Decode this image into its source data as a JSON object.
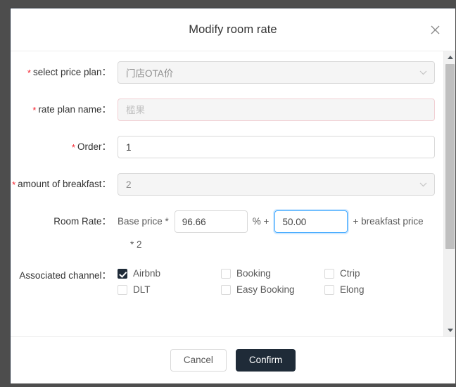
{
  "dialog": {
    "title": "Modify room rate",
    "close_icon": "close-icon"
  },
  "form": {
    "price_plan": {
      "label": "select price plan",
      "required_mark": "*",
      "value": "门店OTA价",
      "disabled": true,
      "chevron": "chevron-down-icon"
    },
    "rate_plan_name": {
      "label": "rate plan name",
      "required_mark": "*",
      "value": "",
      "placeholder": "槛果",
      "disabled": true,
      "error": true
    },
    "order": {
      "label": "Order",
      "required_mark": "*",
      "value": "1"
    },
    "amount_of_breakfast": {
      "label": "amount of breakfast",
      "required_mark": "*",
      "value": "2",
      "disabled": true,
      "chevron": "chevron-down-icon"
    },
    "room_rate": {
      "label": "Room Rate",
      "prefix_text": "Base price *",
      "base_percent_value": "96.66",
      "percent_symbol": "% +",
      "addon_value": "50.00",
      "suffix_text": "+ breakfast price",
      "second_line": "* 2"
    },
    "associated_channel": {
      "label": "Associated channel",
      "options": [
        {
          "name": "Airbnb",
          "checked": true
        },
        {
          "name": "Booking",
          "checked": false
        },
        {
          "name": "Ctrip",
          "checked": false
        },
        {
          "name": "DLT",
          "checked": false
        },
        {
          "name": "Easy Booking",
          "checked": false
        },
        {
          "name": "Elong",
          "checked": false
        }
      ]
    }
  },
  "scrollbar": {
    "up_icon": "triangle-up-icon",
    "down_icon": "triangle-down-icon"
  },
  "footer": {
    "cancel_label": "Cancel",
    "confirm_label": "Confirm"
  },
  "colors": {
    "primary": "#1f2b38",
    "required": "#f5222d",
    "focus": "#40a9ff",
    "backdrop": "#4d4d4d"
  }
}
